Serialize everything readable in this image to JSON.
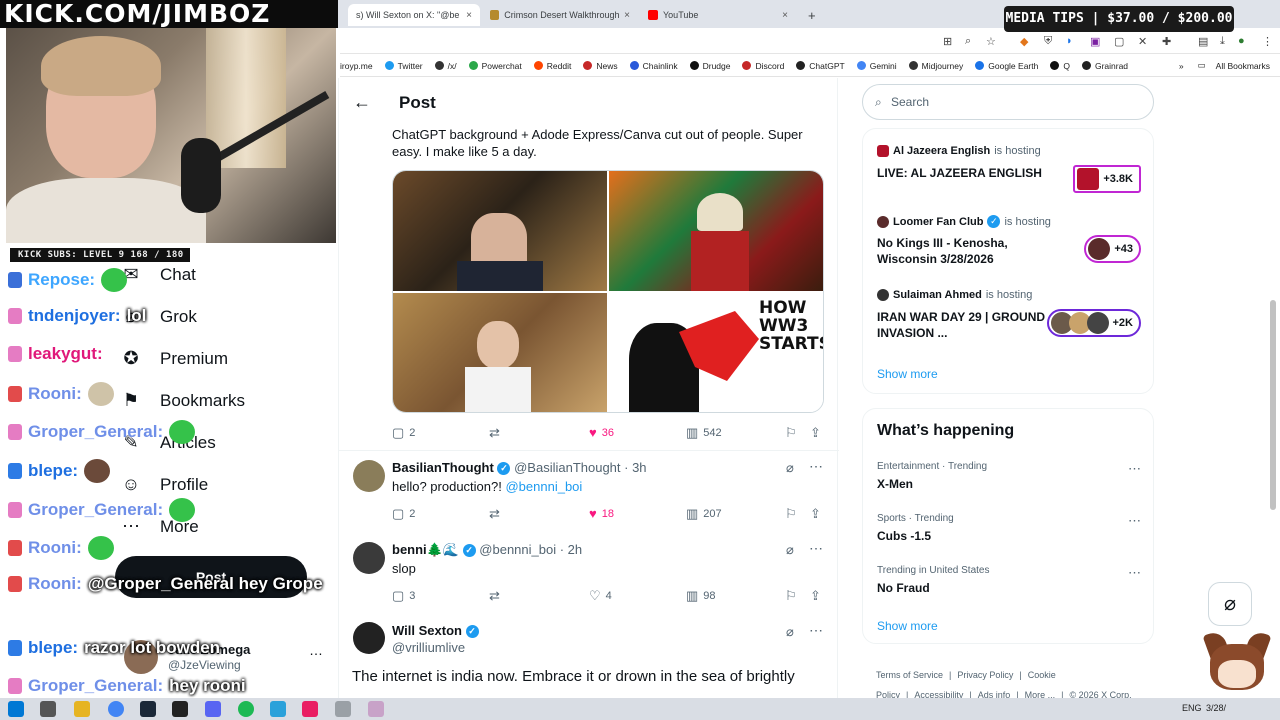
{
  "overlay": {
    "banner": "KICK.COM/JIMBOZ",
    "subs": "KICK SUBS: LEVEL 9 168 / 180",
    "media_tips": "MEDIA TIPS | $37.00 / $200.00"
  },
  "browser": {
    "tabs": [
      {
        "label": "s) Will Sexton on X: \"@benn",
        "color": "#111111",
        "close": "×"
      },
      {
        "label": "Crimson Desert Walkthrough &",
        "color": "#b58a2d",
        "close": "×"
      },
      {
        "label": "YouTube",
        "color": "#ff0000",
        "close": "×"
      }
    ],
    "new_tab": "+",
    "bookmarks": [
      {
        "label": "iroyp.me",
        "color": ""
      },
      {
        "label": "Twitter",
        "color": "#1d9bf0"
      },
      {
        "label": "/x/",
        "color": "#333333"
      },
      {
        "label": "Powerchat",
        "color": "#2ba84a"
      },
      {
        "label": "Reddit",
        "color": "#ff4500"
      },
      {
        "label": "News",
        "color": "#c62828"
      },
      {
        "label": "Chainlink",
        "color": "#2a5ada"
      },
      {
        "label": "Drudge",
        "color": "#111111"
      },
      {
        "label": "Discord",
        "color": "#c62828"
      },
      {
        "label": "ChatGPT",
        "color": "#222222"
      },
      {
        "label": "Gemini",
        "color": "#4285f4"
      },
      {
        "label": "Midjourney",
        "color": "#333333"
      },
      {
        "label": "Google Earth",
        "color": "#1a73e8"
      },
      {
        "label": "Q",
        "color": "#111111"
      },
      {
        "label": "Grainrad",
        "color": "#222222"
      }
    ],
    "bookmarks_overflow": "»",
    "all_bookmarks": "All Bookmarks"
  },
  "xnav": {
    "items": [
      {
        "label": "Chat",
        "icon": "chat-icon",
        "glyph": "✉"
      },
      {
        "label": "Grok",
        "icon": "grok-icon",
        "glyph": "⌀"
      },
      {
        "label": "Premium",
        "icon": "premium-icon",
        "glyph": "✪"
      },
      {
        "label": "Bookmarks",
        "icon": "bookmark-icon",
        "glyph": "⚑"
      },
      {
        "label": "Articles",
        "icon": "articles-icon",
        "glyph": "✎"
      },
      {
        "label": "Profile",
        "icon": "profile-icon",
        "glyph": "☺"
      },
      {
        "label": "More",
        "icon": "more-icon",
        "glyph": "⋯"
      }
    ],
    "post_button": "Post",
    "account": {
      "name": "Jake Zomega",
      "handle": "@JzeViewing",
      "more": "…"
    }
  },
  "chat": {
    "lines": [
      {
        "user": "Repose:",
        "color": "#3ea6ff",
        "msg": ""
      },
      {
        "user": "tndenjoyer:",
        "color": "#1e6fe0",
        "msg": "lol"
      },
      {
        "user": "leakygut:",
        "color": "#e0187a",
        "msg": ""
      },
      {
        "user": "Rooni:",
        "color": "#6f8fe8",
        "msg": ""
      },
      {
        "user": "Groper_General:",
        "color": "#6f8fe8",
        "msg": ""
      },
      {
        "user": "blepe:",
        "color": "#1e6fe0",
        "msg": ""
      },
      {
        "user": "Groper_General:",
        "color": "#6f8fe8",
        "msg": ""
      },
      {
        "user": "Rooni:",
        "color": "#6f8fe8",
        "msg": ""
      },
      {
        "user": "Rooni:",
        "color": "#6f8fe8",
        "msg": "@Groper_General hey Grope"
      },
      {
        "user": "blepe:",
        "color": "#1e6fe0",
        "msg": "razor lot bowden"
      },
      {
        "user": "Groper_General:",
        "color": "#6f8fe8",
        "msg": "hey rooni"
      }
    ]
  },
  "post": {
    "header": "Post",
    "back": "←",
    "text": "ChatGPT background + Adode Express/Canva cut out of people. Super easy. I make like 5 a day.",
    "overlay_text": "HOW WW3 STARTS",
    "stats": {
      "replies": "2",
      "retweets": "",
      "likes": "36",
      "views": "542"
    }
  },
  "replies": [
    {
      "name": "BasilianThought",
      "handle": "@BasilianThought · 3h",
      "text": "hello? production?! ",
      "mention": "@bennni_boi",
      "replies": "2",
      "likes": "18",
      "views": "207",
      "avatar": "#8a7d5a"
    },
    {
      "name": "benni🌲🌊",
      "handle": "@bennni_boi · 2h",
      "text": "slop",
      "mention": "",
      "replies": "3",
      "likes": "4",
      "views": "98",
      "avatar": "#3a3a3a"
    }
  ],
  "author": {
    "name": "Will Sexton",
    "handle": "@vrilliumlive",
    "text": "The internet is india now. Embrace it or drown in the sea of brightly"
  },
  "sidebar": {
    "search_placeholder": "Search",
    "live": [
      {
        "host": "Al Jazeera English",
        "suffix": "is hosting",
        "title": "LIVE: AL JAZEERA ENGLISH",
        "count": "+3.8K",
        "color": "#b3122b"
      },
      {
        "host": "Loomer Fan Club",
        "suffix": "is hosting",
        "title": "No Kings III - Kenosha, Wisconsin 3/28/2026",
        "count": "+43",
        "color": "#5a2b2b"
      },
      {
        "host": "Sulaiman Ahmed",
        "suffix": "is hosting",
        "title": "IRAN WAR DAY 29 | GROUND INVASION ...",
        "count": "+2K",
        "color": "#333333"
      }
    ],
    "show_more_1": "Show more",
    "happening_title": "What’s happening",
    "trends": [
      {
        "category": "Entertainment · Trending",
        "name": "X-Men"
      },
      {
        "category": "Sports · Trending",
        "name": "Cubs -1.5"
      },
      {
        "category": "Trending in United States",
        "name": "No Fraud"
      }
    ],
    "show_more_2": "Show more",
    "footer": [
      "Terms of Service",
      "Privacy Policy",
      "Cookie Policy",
      "Accessibility",
      "Ads info",
      "More ...",
      "© 2026 X Corp."
    ]
  },
  "taskbar": {
    "tray": "ENG",
    "time": "3/28/"
  }
}
